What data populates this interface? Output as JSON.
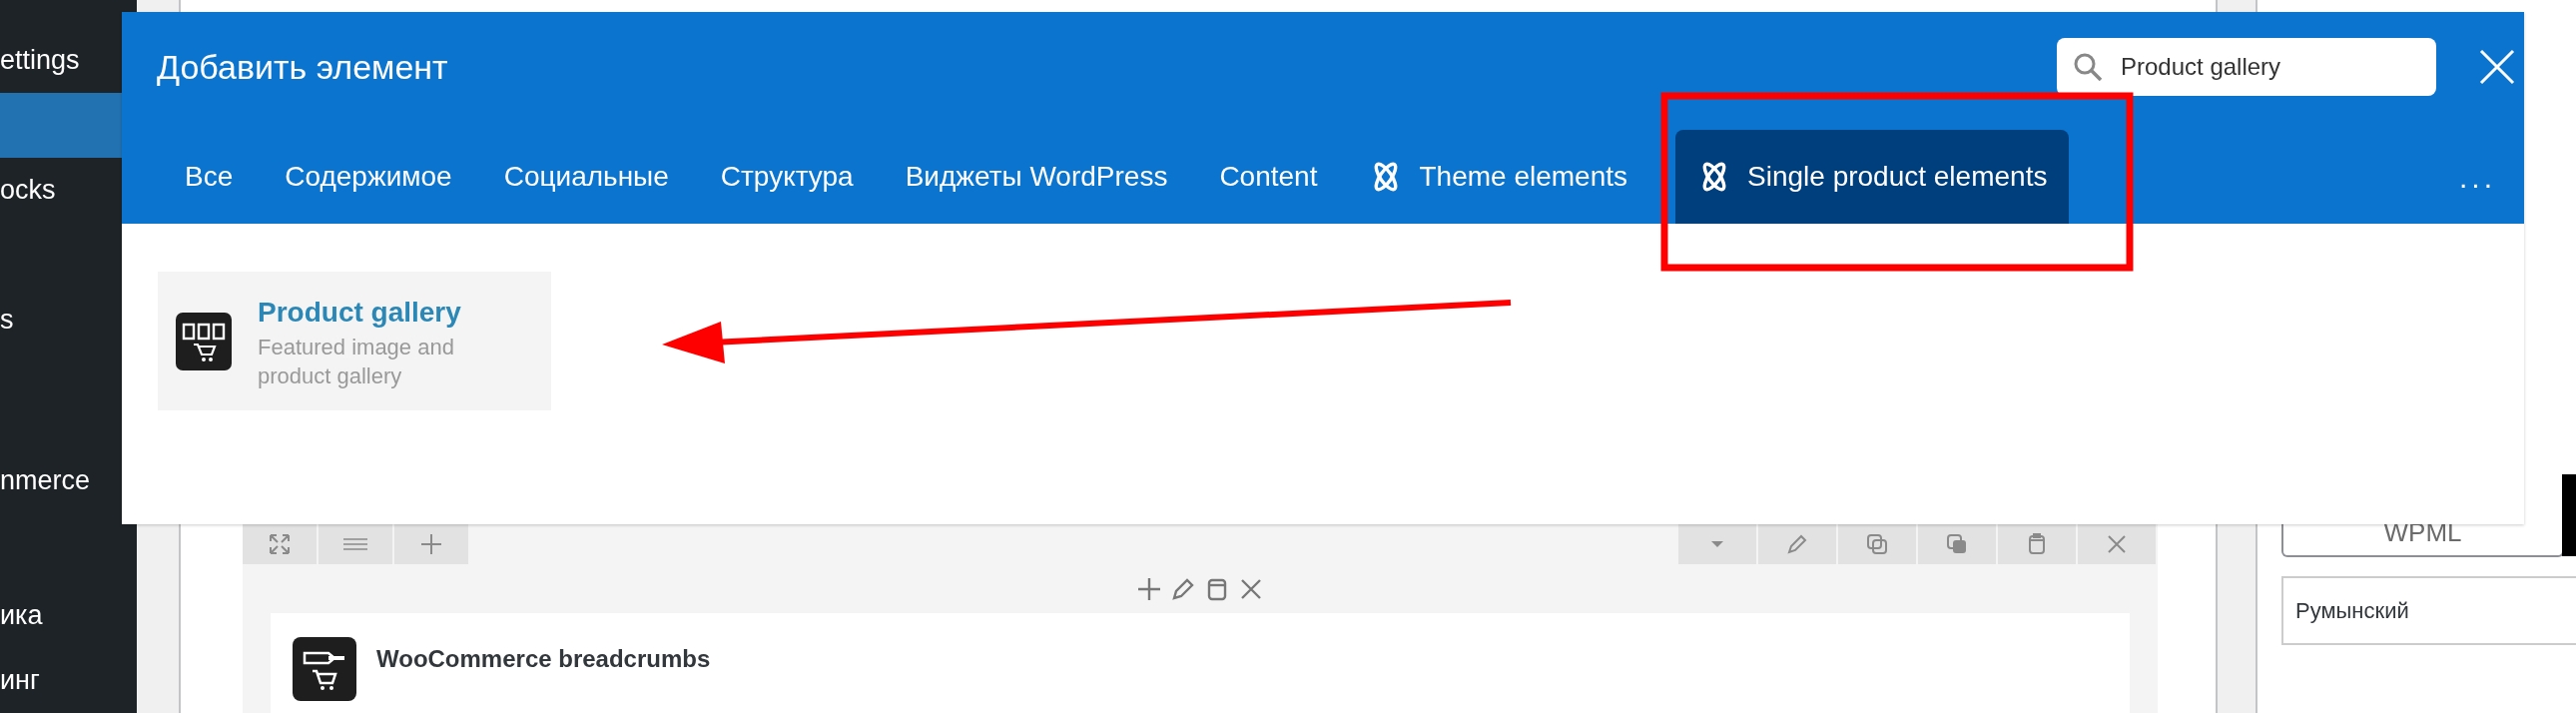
{
  "sidebar": {
    "items": [
      {
        "label": "ettings",
        "selected": false
      },
      {
        "selected": true
      },
      {
        "label": "ocks",
        "selected": false
      },
      {
        "label": "s",
        "selected": false
      },
      {
        "label": "nmerce",
        "selected": false
      },
      {
        "label": "ика",
        "selected": false
      },
      {
        "label": "инг",
        "selected": false
      }
    ]
  },
  "builder": {
    "element": {
      "title": "WooCommerce breadcrumbs"
    }
  },
  "right_panel": {
    "button": "WPML",
    "language_field": {
      "value": "Румынский"
    }
  },
  "modal": {
    "title": "Добавить элемент",
    "search": {
      "value": "Product gallery"
    },
    "tabs": [
      {
        "label": "Все",
        "kind": "plain",
        "selected": false
      },
      {
        "label": "Содержимое",
        "kind": "plain",
        "selected": false
      },
      {
        "label": "Социальные",
        "kind": "plain",
        "selected": false
      },
      {
        "label": "Структура",
        "kind": "plain",
        "selected": false
      },
      {
        "label": "Виджеты WordPress",
        "kind": "plain",
        "selected": false
      },
      {
        "label": "Content",
        "kind": "plain",
        "selected": false
      },
      {
        "label": "Theme elements",
        "kind": "theme",
        "selected": false
      },
      {
        "label": "Single product elements",
        "kind": "theme",
        "selected": true
      }
    ],
    "more": "...",
    "elements": [
      {
        "title": "Product gallery",
        "description": "Featured image and product gallery"
      }
    ]
  },
  "annotations": [
    {
      "kind": "box"
    },
    {
      "kind": "arrow"
    }
  ]
}
